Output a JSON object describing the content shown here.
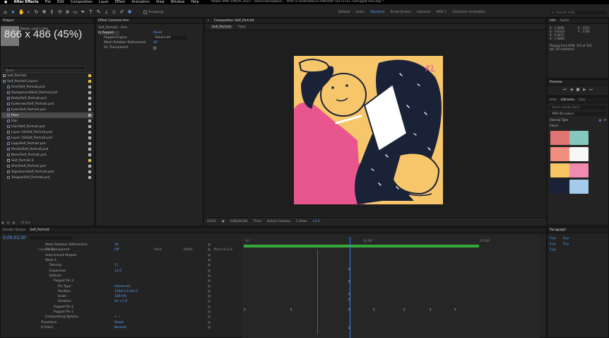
{
  "menubar": {
    "apple": "",
    "items": [
      "After Effects",
      "File",
      "Edit",
      "Composition",
      "Layer",
      "Effect",
      "Animation",
      "View",
      "Window",
      "Help"
    ]
  },
  "window": {
    "title": "Adobe After Effects 2023 - /Users/a/Dropbox/... YAYA STUDIO/SKILLS-HARD/AFTER EFFECTS/Puppet tool.aep *"
  },
  "toolbar": {
    "snapping": "Snapping",
    "workspaces": [
      "Default",
      "Learn",
      "Standard",
      "Small Screen",
      "Libraries",
      "YAYA 1",
      "Character Animation"
    ],
    "active_workspace": "Standard",
    "search_placeholder": "Search Help"
  },
  "overlay": {
    "size_label": "866 x 486 (45%)"
  },
  "project": {
    "tab": "Project",
    "info_line1": "Resize, used 1 time",
    "info_line2": "Δ 0;00;00;00, 29.97 fps",
    "columns": [
      "Name"
    ],
    "items": [
      {
        "name": "Self_Portrait",
        "type": "comp",
        "color": "#e8c342"
      },
      {
        "name": "Self_Portrait Layers",
        "type": "folder",
        "color": "#e8c342"
      },
      {
        "name": "Arm/Self_Portrait.psd",
        "type": "file",
        "color": "#b2b2b2"
      },
      {
        "name": "Background/Self_Portrait.psd",
        "type": "file",
        "color": "#b2b2b2"
      },
      {
        "name": "Body/Self_Portrait.psd",
        "type": "file",
        "color": "#b2b2b2"
      },
      {
        "name": "Eyebrows/Self_Portrait.psd",
        "type": "file",
        "color": "#b2b2b2"
      },
      {
        "name": "Eyes/Self_Portrait.psd",
        "type": "file",
        "color": "#b2b2b2"
      },
      {
        "name": "Face",
        "type": "file",
        "color": "#b2b2b2",
        "selected": true
      },
      {
        "name": "Hair",
        "type": "file",
        "color": "#b2b2b2"
      },
      {
        "name": "Hair/Self_Portrait.psd",
        "type": "file",
        "color": "#b2b2b2"
      },
      {
        "name": "Layer 14/Self_Portrait.psd",
        "type": "file",
        "color": "#b2b2b2"
      },
      {
        "name": "Layer 15/Self_Portrait.psd",
        "type": "file",
        "color": "#b2b2b2"
      },
      {
        "name": "Legs/Self_Portrait.psd",
        "type": "file",
        "color": "#b2b2b2"
      },
      {
        "name": "Mouth/Self_Portrait.psd",
        "type": "file",
        "color": "#b2b2b2"
      },
      {
        "name": "Nose/Self_Portrait.psd",
        "type": "file",
        "color": "#b2b2b2"
      },
      {
        "name": "Self_Portrait 2",
        "type": "comp",
        "color": "#e8c342"
      },
      {
        "name": "Shirt/Self_Portrait.psd",
        "type": "file",
        "color": "#b2b2b2"
      },
      {
        "name": "Signature/Self_Portrait.psd",
        "type": "file",
        "color": "#b2b2b2"
      },
      {
        "name": "Tongue/Self_Portrait.psd",
        "type": "file",
        "color": "#b2b2b2"
      }
    ],
    "footer_bpc": "32 bpc"
  },
  "effects": {
    "tab": "Effect Controls Arm",
    "path": "Self_Portrait - Arm",
    "rows": [
      {
        "label": "fx  Puppet",
        "value": "Reset"
      },
      {
        "label": "Puppet Engine",
        "value": "Advanced"
      },
      {
        "label": "Mesh Rotation Refinement",
        "value": "20"
      },
      {
        "label": "On Transparent",
        "value": ""
      }
    ]
  },
  "composition": {
    "tab": "Composition Self_Portrait",
    "crumbs": [
      "Self_Portrait",
      "Face"
    ],
    "zoom": "232%",
    "timecode": "0;00;00;00",
    "resolution": "Third",
    "camera": "Active Camera",
    "views": "1 View",
    "exposure": "+0.0"
  },
  "info": {
    "tabs": [
      "Info",
      "Audio"
    ],
    "rgba": [
      "R : 1.0000",
      "G : 0.8314",
      "B : 0.4471",
      "A : 1.0000"
    ],
    "coords": [
      "X : 2253",
      "Y : 1706"
    ],
    "status1": "Playing from RAM: 103 of 103",
    "status2": "fps: 29 (realtime)"
  },
  "preview": {
    "tab": "Preview"
  },
  "libraries": {
    "tabs": [
      "ents",
      "Libraries",
      "Cha"
    ],
    "search_placeholder": "Search Adobe Stock",
    "library": "YAYA 06 colours",
    "view_by": "View by Type",
    "section": "Colors",
    "swatches": [
      "#e07573",
      "#86c8be",
      "#f08f80",
      "#f7f7f7",
      "#f7c563",
      "#ee8bae",
      "#1a2238",
      "#a5cbea"
    ]
  },
  "timeline": {
    "tabs": [
      "Render Queue",
      "Self_Portrait"
    ],
    "current_time": "0;00;01;30",
    "fps_hint": "00040 (29.97 fps)",
    "header": [
      "Layer Name",
      "Mode",
      "TrkMat",
      "Parent & Link"
    ],
    "rows": [
      {
        "name": "Mesh Rotation Refinement",
        "value": "20",
        "indent": 14
      },
      {
        "name": "On Transparent",
        "value": "Off",
        "indent": 14
      },
      {
        "name": "Auto-traced Shapes",
        "value": "",
        "indent": 14
      },
      {
        "name": "Mesh 1",
        "value": "",
        "indent": 14
      },
      {
        "name": "Density",
        "value": "11",
        "indent": 20
      },
      {
        "name": "Expansion",
        "value": "12.0",
        "indent": 20
      },
      {
        "name": "Deform",
        "value": "",
        "indent": 20
      },
      {
        "name": "Puppet Pin 3",
        "value": "",
        "indent": 26
      },
      {
        "name": "Pin Type",
        "value": "Advanced",
        "indent": 32
      },
      {
        "name": "Position",
        "value": "1204.0,1534.0",
        "indent": 32
      },
      {
        "name": "Scale",
        "value": "100.0%",
        "indent": 32
      },
      {
        "name": "Rotation",
        "value": "0x +1.2°",
        "indent": 32
      },
      {
        "name": "Puppet Pin 2",
        "value": "",
        "indent": 26
      },
      {
        "name": "Puppet Pin 1",
        "value": "",
        "indent": 26
      },
      {
        "name": "Compositing Options",
        "value": "+ −",
        "indent": 14
      },
      {
        "name": "Transform",
        "value": "Reset",
        "indent": 8
      },
      {
        "name": "6  [Hair]",
        "value": "Normal",
        "indent": 8
      }
    ],
    "parent_none": "None",
    "ruler_marks": [
      "0f",
      "",
      "01:00f",
      "",
      "02:00f",
      ""
    ]
  },
  "paragraph": {
    "tab": "Paragraph",
    "values": [
      "0 px",
      "0 px",
      "0 px",
      "0 px",
      "0 px"
    ]
  }
}
